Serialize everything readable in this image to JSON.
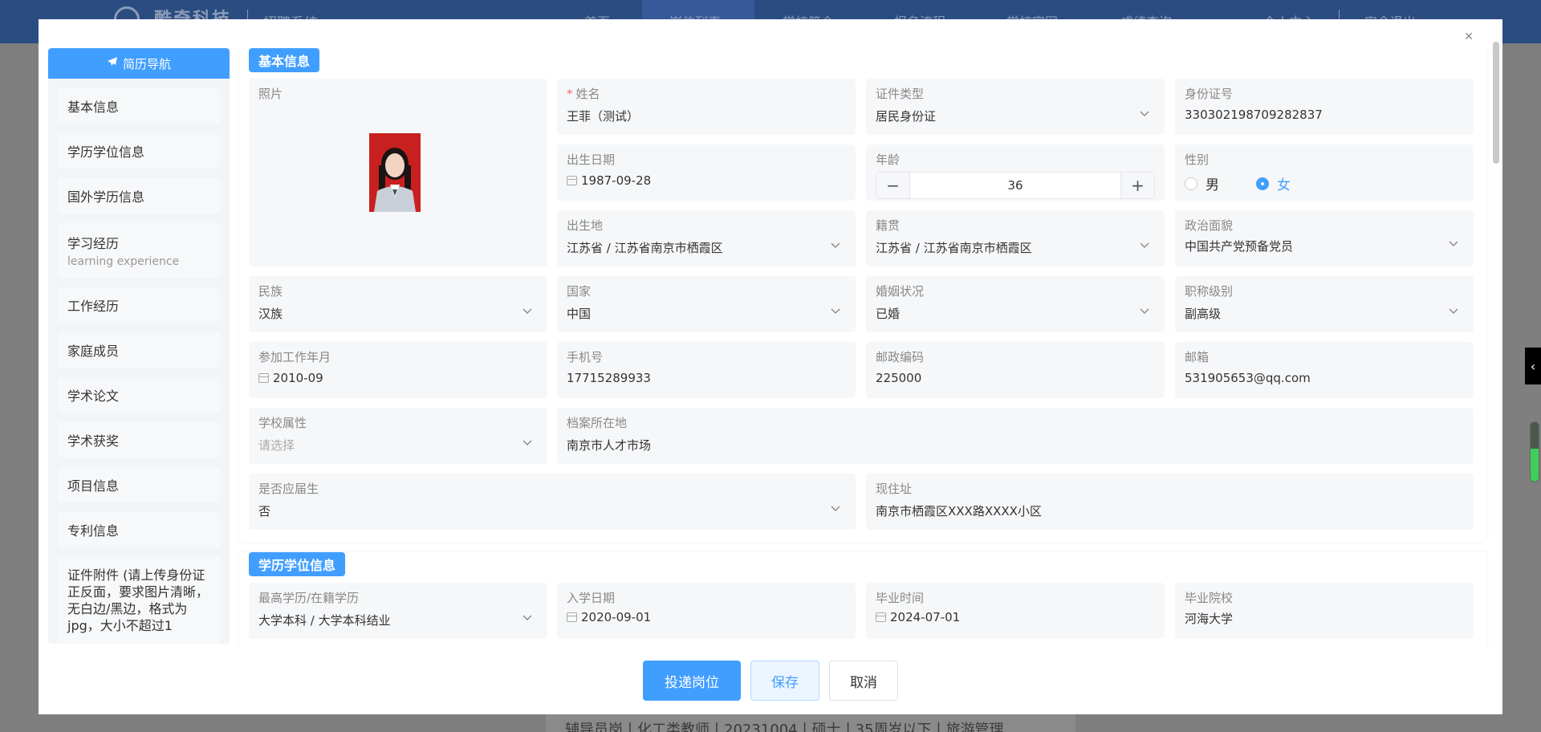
{
  "background": {
    "logo": "酷奇科技",
    "system": "招聘系统",
    "nav": [
      "首页",
      "岗位列表",
      "学校简介",
      "报名流程",
      "学校官网",
      "成绩查询",
      "个人中心",
      "安全退出"
    ],
    "footer_text": "辅导员岗丨化工类教师丨20231004丨硕士丨35周岁以下丨旅游管理"
  },
  "modal": {
    "close_icon": "close-icon",
    "sidebar": {
      "title": "简历导航",
      "items": [
        {
          "label": "基本信息"
        },
        {
          "label": "学历学位信息"
        },
        {
          "label": "国外学历信息"
        },
        {
          "label": "学习经历",
          "sub": "learning experience"
        },
        {
          "label": "工作经历"
        },
        {
          "label": "家庭成员"
        },
        {
          "label": "学术论文"
        },
        {
          "label": "学术获奖"
        },
        {
          "label": "项目信息"
        },
        {
          "label": "专利信息"
        },
        {
          "label": "证件附件 (请上传身份证正反面，要求图片清晰，无白边/黑边，格式为jpg，大小不超过1"
        }
      ]
    },
    "basic": {
      "title": "基本信息",
      "photo_label": "照片",
      "name": {
        "label": "姓名",
        "value": "王菲（测试）"
      },
      "id_type": {
        "label": "证件类型",
        "value": "居民身份证"
      },
      "id_no": {
        "label": "身份证号",
        "value": "330302198709282837"
      },
      "birth": {
        "label": "出生日期",
        "value": "1987-09-28"
      },
      "age": {
        "label": "年龄",
        "value": "36",
        "minus": "−",
        "plus": "+"
      },
      "gender": {
        "label": "性别",
        "male": "男",
        "female": "女",
        "selected": "female"
      },
      "birthplace": {
        "label": "出生地",
        "value": "江苏省 / 江苏省南京市栖霞区"
      },
      "native": {
        "label": "籍贯",
        "value": "江苏省 / 江苏省南京市栖霞区"
      },
      "political": {
        "label": "政治面貌",
        "value": "中国共产党预备党员"
      },
      "ethnic": {
        "label": "民族",
        "value": "汉族"
      },
      "country": {
        "label": "国家",
        "value": "中国"
      },
      "marital": {
        "label": "婚姻状况",
        "value": "已婚"
      },
      "title_level": {
        "label": "职称级别",
        "value": "副高级"
      },
      "work_start": {
        "label": "参加工作年月",
        "value": "2010-09"
      },
      "phone": {
        "label": "手机号",
        "value": "17715289933"
      },
      "postcode": {
        "label": "邮政编码",
        "value": "225000"
      },
      "email": {
        "label": "邮箱",
        "value": "531905653@qq.com"
      },
      "school_attr": {
        "label": "学校属性",
        "placeholder": "请选择"
      },
      "archive": {
        "label": "档案所在地",
        "value": "南京市人才市场"
      },
      "fresh_grad": {
        "label": "是否应届生",
        "value": "否"
      },
      "address": {
        "label": "现住址",
        "value": "南京市栖霞区XXX路XXXX小区"
      }
    },
    "edu": {
      "title": "学历学位信息",
      "degree": {
        "label": "最高学历/在籍学历",
        "value": "大学本科 / 大学本科结业"
      },
      "enroll": {
        "label": "入学日期",
        "value": "2020-09-01"
      },
      "graduate": {
        "label": "毕业时间",
        "value": "2024-07-01"
      },
      "school": {
        "label": "毕业院校",
        "value": "河海大学"
      }
    },
    "buttons": {
      "submit": "投递岗位",
      "save": "保存",
      "cancel": "取消"
    }
  },
  "edge": {
    "collapse_icon": "chevron-left-icon",
    "level": 0.55
  }
}
